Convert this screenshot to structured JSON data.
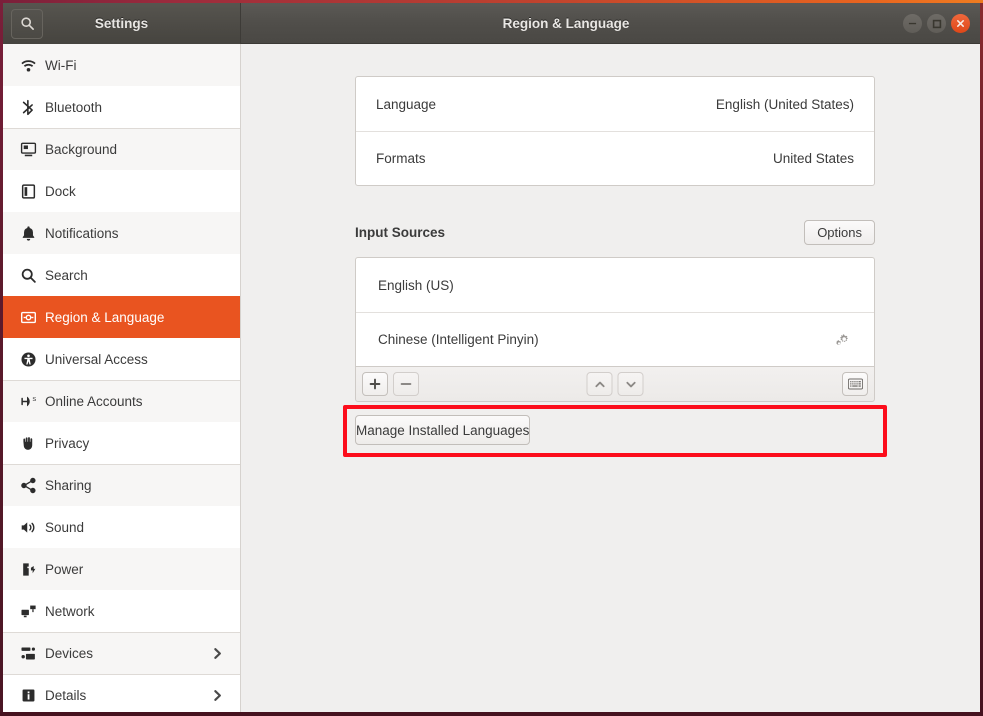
{
  "titlebar": {
    "app_title": "Settings",
    "window_title": "Region & Language",
    "search_icon": "search-icon",
    "controls": {
      "minimize": "minimize-icon",
      "maximize": "maximize-icon",
      "close": "close-icon"
    }
  },
  "colors": {
    "accent": "#e95420",
    "highlight": "#fc0d1b",
    "background": "#f0efee",
    "card": "#ffffff",
    "titlebar": "#504e4a"
  },
  "sidebar": {
    "items": [
      {
        "label": "Wi-Fi",
        "icon": "wifi-icon",
        "selected": false,
        "chevron": false
      },
      {
        "label": "Bluetooth",
        "icon": "bluetooth-icon",
        "selected": false,
        "chevron": false
      },
      {
        "label": "Background",
        "icon": "background-icon",
        "selected": false,
        "chevron": false
      },
      {
        "label": "Dock",
        "icon": "dock-icon",
        "selected": false,
        "chevron": false
      },
      {
        "label": "Notifications",
        "icon": "bell-icon",
        "selected": false,
        "chevron": false
      },
      {
        "label": "Search",
        "icon": "search-icon",
        "selected": false,
        "chevron": false
      },
      {
        "label": "Region & Language",
        "icon": "region-language-icon",
        "selected": true,
        "chevron": false
      },
      {
        "label": "Universal Access",
        "icon": "accessibility-icon",
        "selected": false,
        "chevron": false
      },
      {
        "label": "Online Accounts",
        "icon": "online-accounts-icon",
        "selected": false,
        "chevron": false
      },
      {
        "label": "Privacy",
        "icon": "hand-icon",
        "selected": false,
        "chevron": false
      },
      {
        "label": "Sharing",
        "icon": "share-icon",
        "selected": false,
        "chevron": false
      },
      {
        "label": "Sound",
        "icon": "speaker-icon",
        "selected": false,
        "chevron": false
      },
      {
        "label": "Power",
        "icon": "power-icon",
        "selected": false,
        "chevron": false
      },
      {
        "label": "Network",
        "icon": "network-icon",
        "selected": false,
        "chevron": false
      },
      {
        "label": "Devices",
        "icon": "devices-icon",
        "selected": false,
        "chevron": true
      },
      {
        "label": "Details",
        "icon": "info-icon",
        "selected": false,
        "chevron": true
      }
    ]
  },
  "main": {
    "language_card": [
      {
        "label": "Language",
        "value": "English (United States)"
      },
      {
        "label": "Formats",
        "value": "United States"
      }
    ],
    "input_sources": {
      "title": "Input Sources",
      "options_label": "Options",
      "sources": [
        {
          "label": "English (US)",
          "has_gear": false
        },
        {
          "label": "Chinese (Intelligent Pinyin)",
          "has_gear": true
        }
      ],
      "toolbar": {
        "add": "+",
        "remove": "−",
        "move_up": "chevron-up-icon",
        "move_down": "chevron-down-icon",
        "keyboard_preview": "keyboard-icon"
      }
    },
    "manage_button_label": "Manage Installed Languages"
  }
}
